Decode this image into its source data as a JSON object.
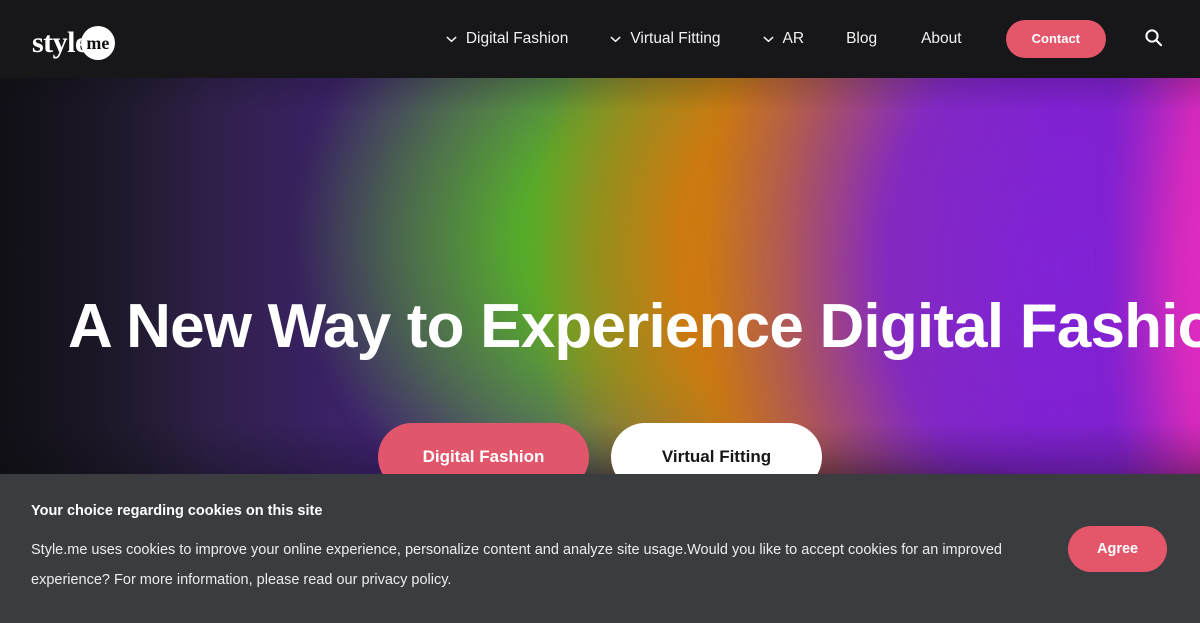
{
  "colors": {
    "accent_pink": "#e4566a",
    "header_bg": "#17171a",
    "cookie_bg": "#3a3c3f",
    "text_light": "#ffffff",
    "hero_purple": "#7a22c8",
    "hero_green": "#6ce828",
    "hero_orange": "#d47c10",
    "hero_magenta": "#ee2ec4"
  },
  "header": {
    "logo": {
      "word": "style",
      "badge": "me"
    },
    "nav": [
      {
        "label": "Digital Fashion",
        "has_dropdown": true,
        "icon": "chevron-down-icon"
      },
      {
        "label": "Virtual Fitting",
        "has_dropdown": true,
        "icon": "chevron-down-icon"
      },
      {
        "label": "AR",
        "has_dropdown": true,
        "icon": "chevron-down-icon"
      },
      {
        "label": "Blog",
        "has_dropdown": false
      },
      {
        "label": "About",
        "has_dropdown": false
      }
    ],
    "contact_label": "Contact",
    "search_icon": "search-icon"
  },
  "hero": {
    "title": "A New Way to Experience Digital Fashion",
    "buttons": [
      {
        "label": "Digital Fashion",
        "style": "primary"
      },
      {
        "label": "Virtual Fitting",
        "style": "light"
      }
    ]
  },
  "cookie_banner": {
    "title": "Your choice regarding cookies on this site",
    "body": "Style.me uses cookies to improve your online experience, personalize content and analyze site usage.Would you like to accept cookies for an improved experience? For more information, please read our privacy policy.",
    "agree_label": "Agree"
  }
}
